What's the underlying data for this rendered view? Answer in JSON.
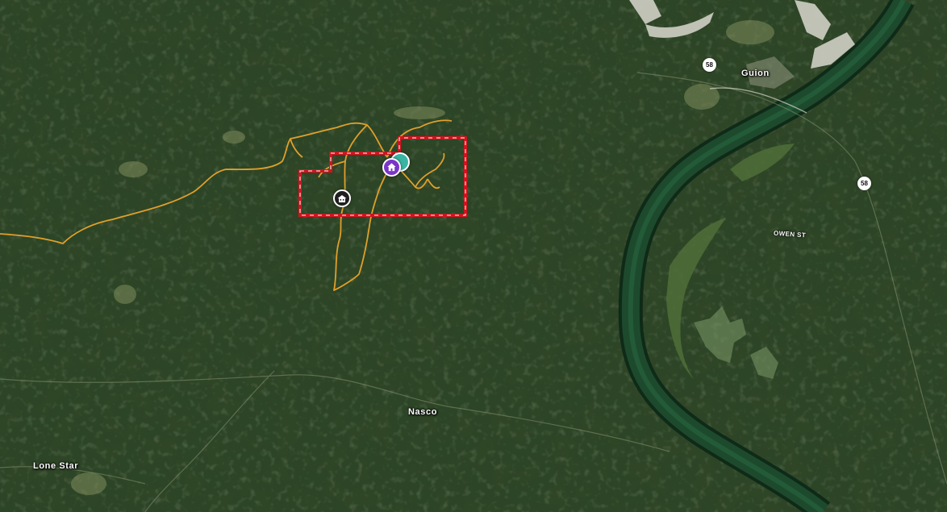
{
  "map": {
    "view": "satellite",
    "colors": {
      "boundary": "#d0141e",
      "boundary_dash": "#ffffff",
      "trail": "#e0a02a",
      "river": "#1d4a2c",
      "river_edge": "#0f2a18",
      "house_marker": "#7a35c9",
      "cluster_marker": "#3ab5a4",
      "cabin_marker": "#1f1f1f"
    }
  },
  "labels": {
    "guion": "Guion",
    "nasco": "Nasco",
    "lone_star": "Lone Star",
    "owen_st": "OWEN ST"
  },
  "shields": {
    "route_58_north": "58",
    "route_58_east": "58"
  },
  "markers": {
    "house": {
      "icon": "house-icon"
    },
    "cluster": {
      "icon": "cluster-icon"
    },
    "cabin": {
      "icon": "cabin-icon"
    }
  }
}
